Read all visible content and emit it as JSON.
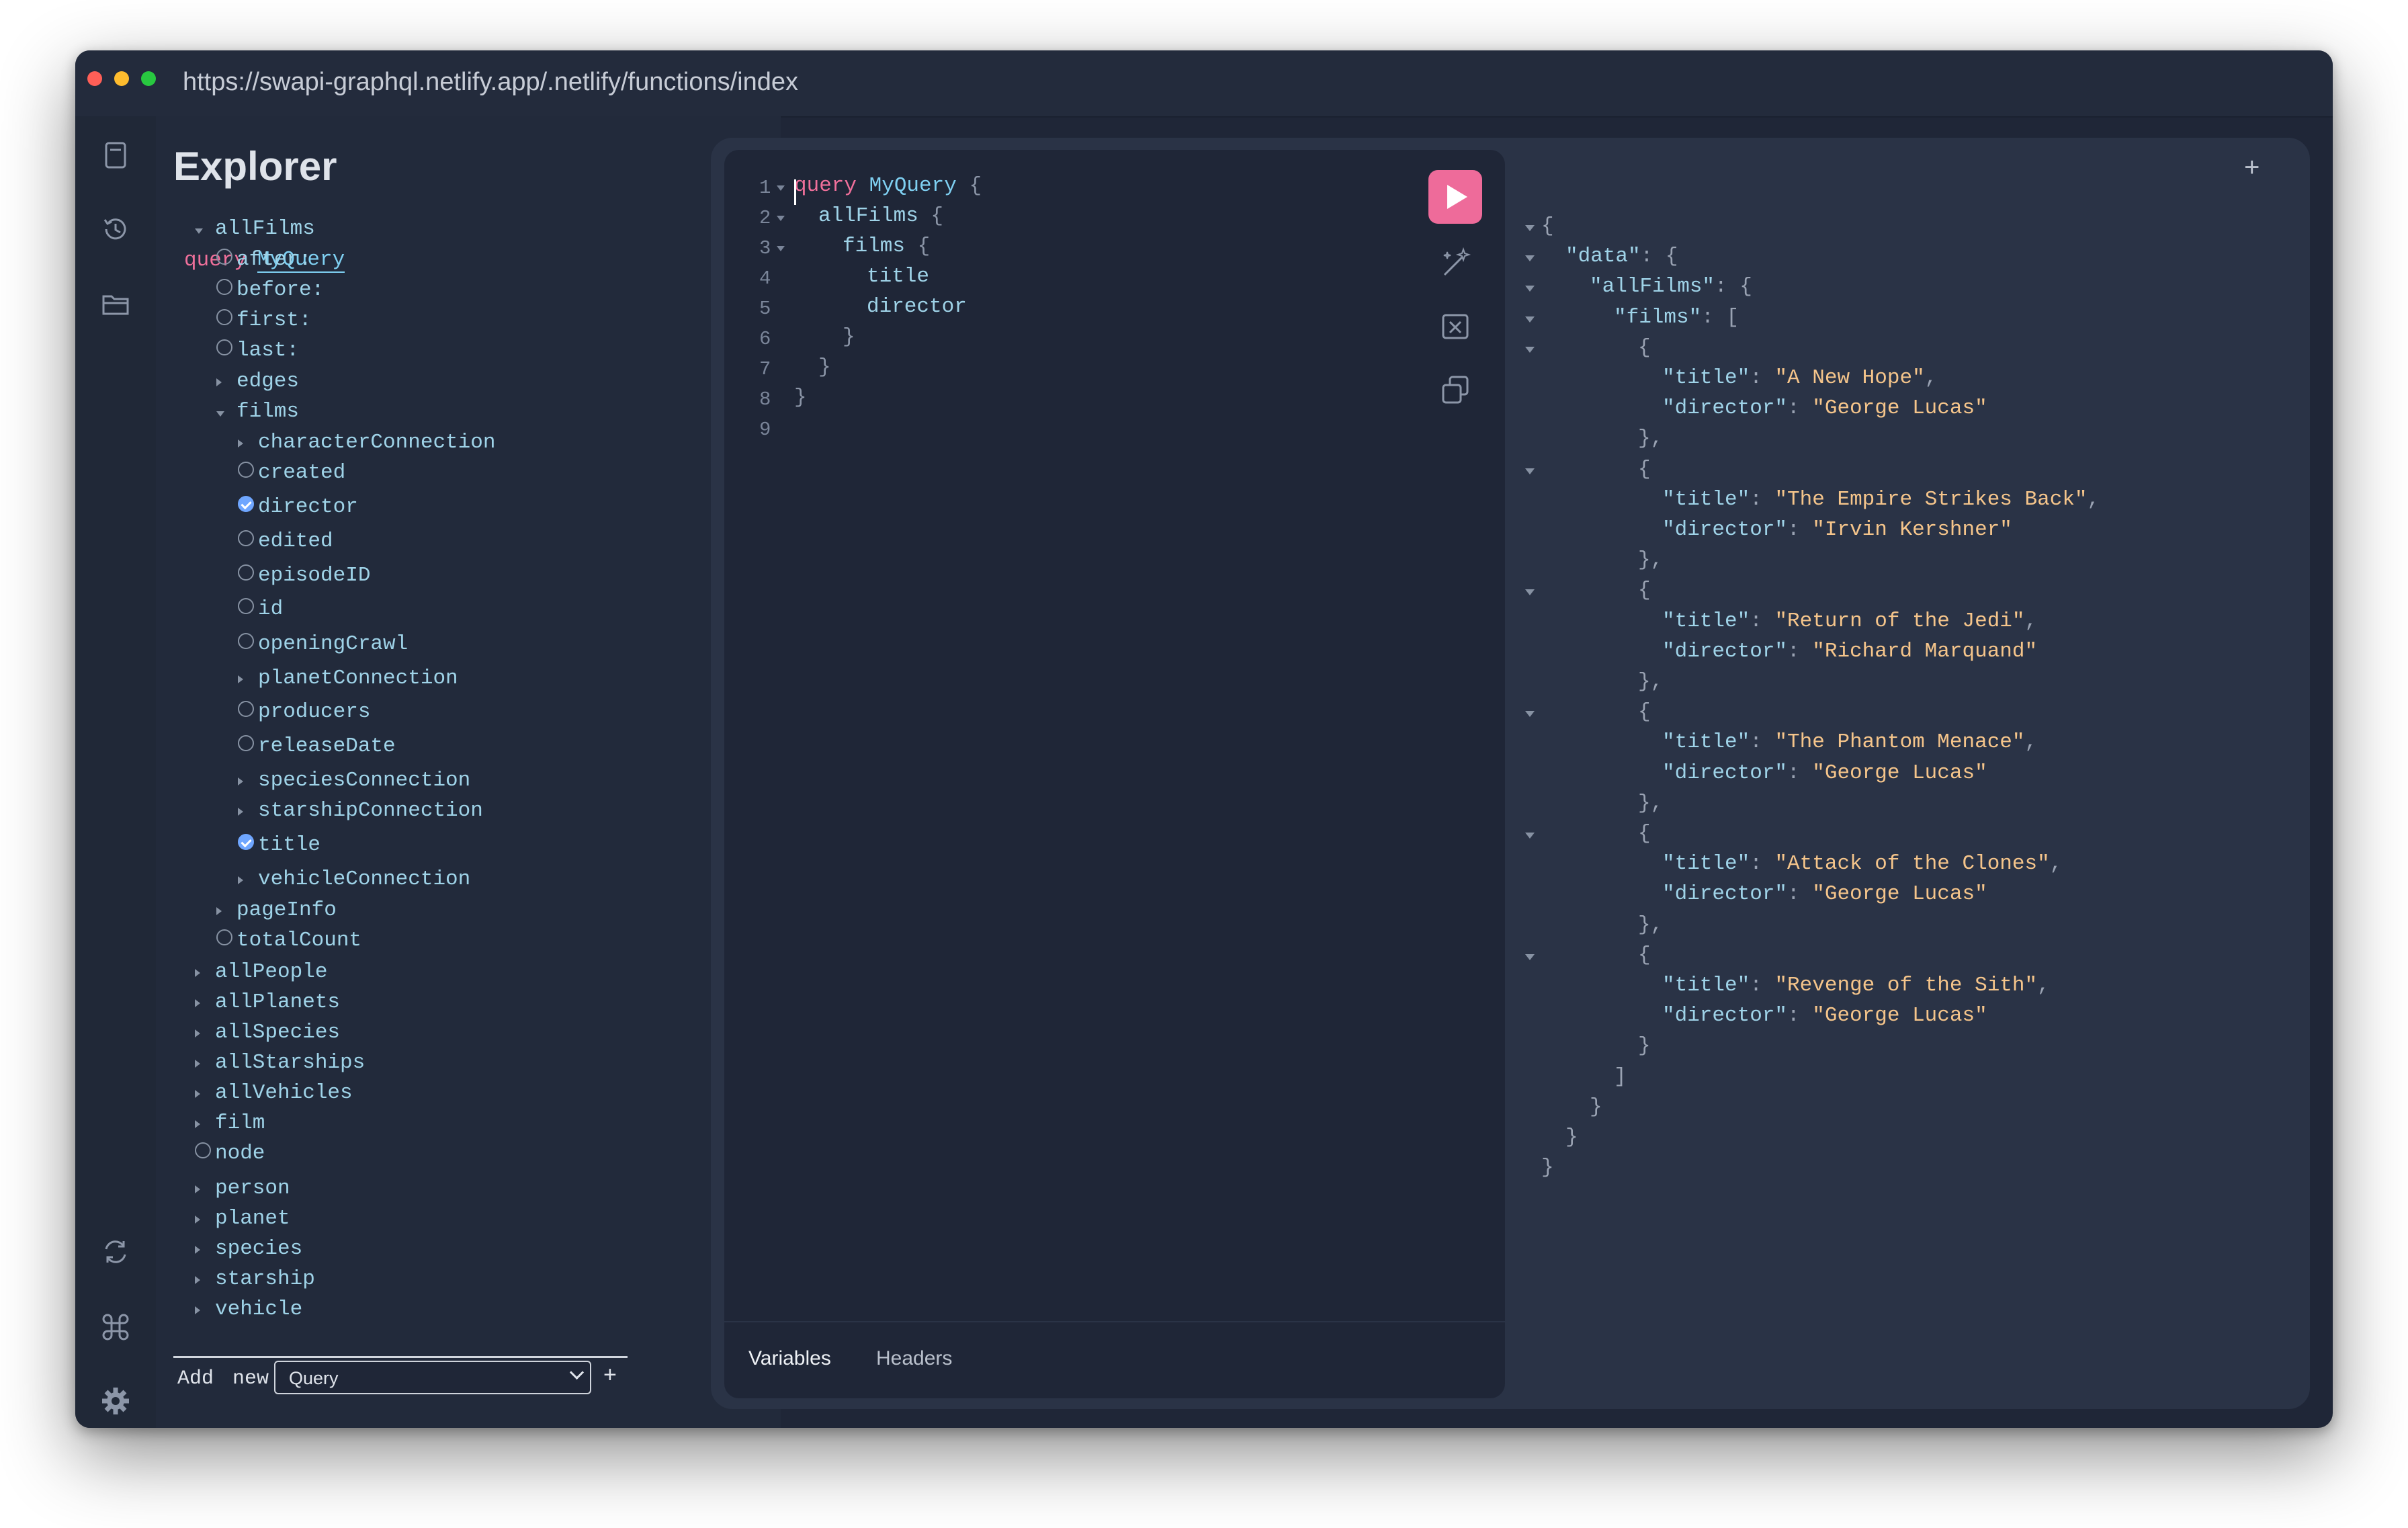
{
  "window": {
    "url": "https://swapi-graphql.netlify.app/.netlify/functions/index"
  },
  "sidebar_icons": [
    "docs-icon",
    "history-icon",
    "folder-icon",
    "refresh-icon",
    "command-icon",
    "settings-icon"
  ],
  "explorer": {
    "title": "Explorer",
    "query_keyword": "query",
    "query_name": "MyQuery",
    "add_new_label": "Add",
    "add_new_label2": "new",
    "add_new_select": "Query",
    "add_button": "+"
  },
  "tree": [
    {
      "label": "allFilms",
      "kind": "open"
    },
    {
      "label": "after:",
      "kind": "radio"
    },
    {
      "label": "before:",
      "kind": "radio"
    },
    {
      "label": "first:",
      "kind": "radio"
    },
    {
      "label": "last:",
      "kind": "radio"
    },
    {
      "label": "edges",
      "kind": "closed"
    },
    {
      "label": "films",
      "kind": "open"
    },
    {
      "label": "characterConnection",
      "kind": "closed"
    },
    {
      "label": "created",
      "kind": "radio"
    },
    {
      "label": "director",
      "kind": "checked"
    },
    {
      "label": "edited",
      "kind": "radio"
    },
    {
      "label": "episodeID",
      "kind": "radio"
    },
    {
      "label": "id",
      "kind": "radio"
    },
    {
      "label": "openingCrawl",
      "kind": "radio"
    },
    {
      "label": "planetConnection",
      "kind": "closed"
    },
    {
      "label": "producers",
      "kind": "radio"
    },
    {
      "label": "releaseDate",
      "kind": "radio"
    },
    {
      "label": "speciesConnection",
      "kind": "closed"
    },
    {
      "label": "starshipConnection",
      "kind": "closed"
    },
    {
      "label": "title",
      "kind": "checked"
    },
    {
      "label": "vehicleConnection",
      "kind": "closed"
    },
    {
      "label": "pageInfo",
      "kind": "closed"
    },
    {
      "label": "totalCount",
      "kind": "radio"
    },
    {
      "label": "allPeople",
      "kind": "closed"
    },
    {
      "label": "allPlanets",
      "kind": "closed"
    },
    {
      "label": "allSpecies",
      "kind": "closed"
    },
    {
      "label": "allStarships",
      "kind": "closed"
    },
    {
      "label": "allVehicles",
      "kind": "closed"
    },
    {
      "label": "film",
      "kind": "closed"
    },
    {
      "label": "node",
      "kind": "radio"
    },
    {
      "label": "person",
      "kind": "closed"
    },
    {
      "label": "planet",
      "kind": "closed"
    },
    {
      "label": "species",
      "kind": "closed"
    },
    {
      "label": "starship",
      "kind": "closed"
    },
    {
      "label": "vehicle",
      "kind": "closed"
    }
  ],
  "editor": {
    "line_numbers": [
      "1",
      "2",
      "3",
      "4",
      "5",
      "6",
      "7",
      "8",
      "9"
    ],
    "lines": [
      {
        "kw": "query",
        "name": " MyQuery",
        "rest": " {"
      },
      {
        "field": "allFilms",
        "rest": " {"
      },
      {
        "field": "films",
        "rest": " {"
      },
      {
        "field": "title",
        "rest": ""
      },
      {
        "field": "director",
        "rest": ""
      },
      {
        "field": "",
        "rest": "}"
      },
      {
        "field": "",
        "rest": "}"
      },
      {
        "field": "",
        "rest": "}"
      },
      {
        "field": "",
        "rest": ""
      }
    ],
    "tabs": {
      "variables": "Variables",
      "headers": "Headers"
    },
    "add_tab": "+"
  },
  "result": {
    "films": [
      {
        "title": "A New Hope",
        "director": "George Lucas"
      },
      {
        "title": "The Empire Strikes Back",
        "director": "Irvin Kershner"
      },
      {
        "title": "Return of the Jedi",
        "director": "Richard Marquand"
      },
      {
        "title": "The Phantom Menace",
        "director": "George Lucas"
      },
      {
        "title": "Attack of the Clones",
        "director": "George Lucas"
      },
      {
        "title": "Revenge of the Sith",
        "director": "George Lucas"
      }
    ],
    "keys": {
      "data": "\"data\"",
      "allFilms": "\"allFilms\"",
      "films": "\"films\"",
      "title": "\"title\"",
      "director": "\"director\""
    }
  },
  "colors": {
    "accent": "#ee6b9a",
    "keyword": "#f0709b",
    "field": "#9fd3e8",
    "string": "#f5c58b"
  }
}
